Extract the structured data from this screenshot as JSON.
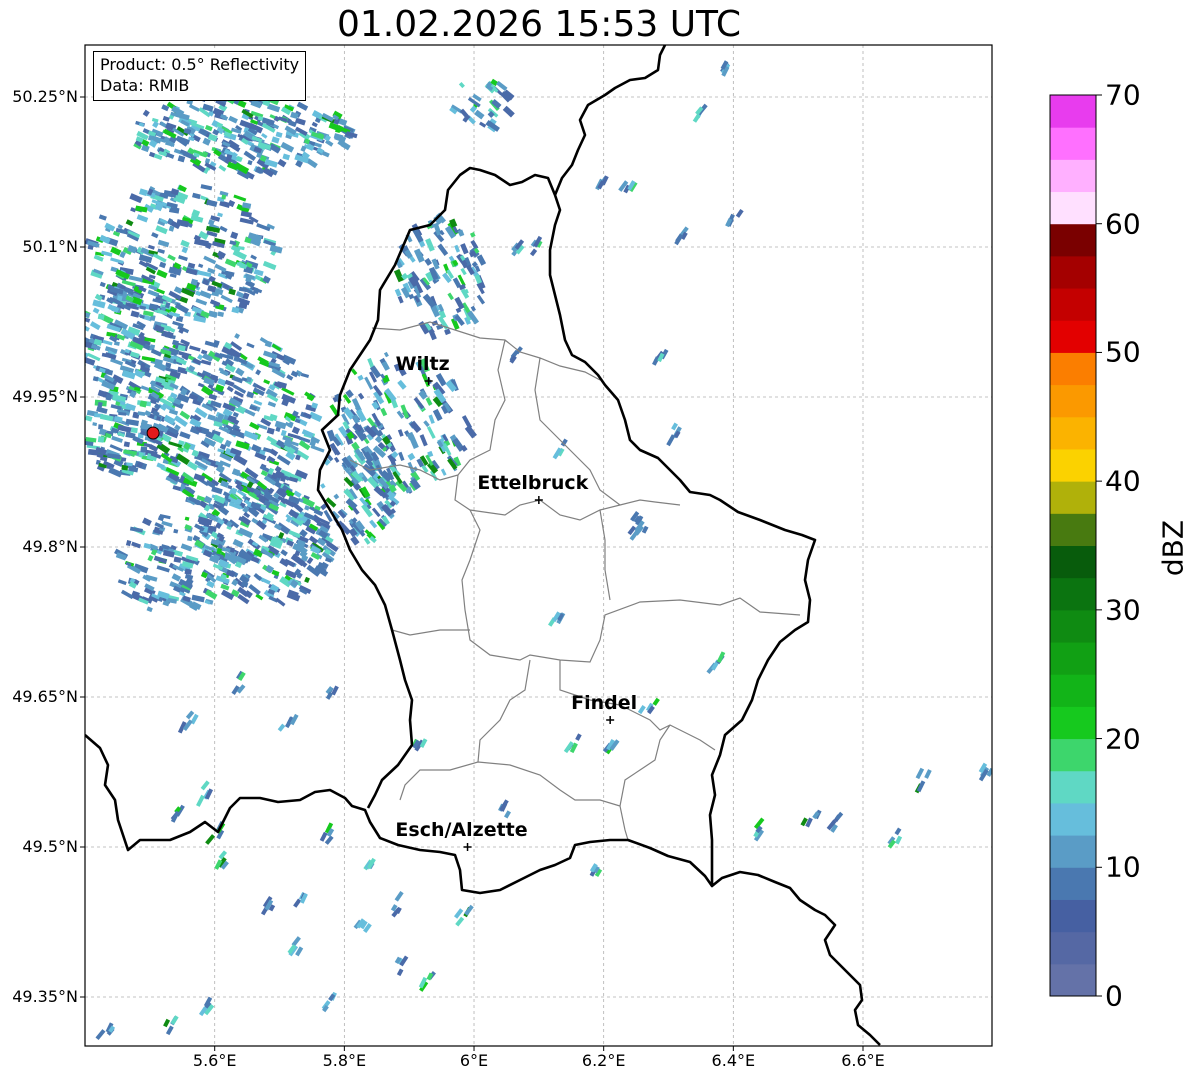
{
  "title": "01.02.2026 15:53 UTC",
  "info": {
    "product": "Product: 0.5° Reflectivity",
    "data": "Data: RMIB"
  },
  "lat_ticks": [
    {
      "value": 50.25,
      "label": "50.25°N"
    },
    {
      "value": 50.1,
      "label": "50.1°N"
    },
    {
      "value": 49.95,
      "label": "49.95°N"
    },
    {
      "value": 49.8,
      "label": "49.8°N"
    },
    {
      "value": 49.65,
      "label": "49.65°N"
    },
    {
      "value": 49.5,
      "label": "49.5°N"
    },
    {
      "value": 49.35,
      "label": "49.35°N"
    }
  ],
  "lon_ticks": [
    {
      "value": 5.6,
      "label": "5.6°E"
    },
    {
      "value": 5.8,
      "label": "5.8°E"
    },
    {
      "value": 6.0,
      "label": "6°E"
    },
    {
      "value": 6.2,
      "label": "6.2°E"
    },
    {
      "value": 6.4,
      "label": "6.4°E"
    },
    {
      "value": 6.6,
      "label": "6.6°E"
    }
  ],
  "cities": [
    {
      "name": "Wiltz",
      "lon": 5.93,
      "lat": 49.966
    },
    {
      "name": "Ettelbruck",
      "lon": 6.1,
      "lat": 49.847
    },
    {
      "name": "Findel",
      "lon": 6.21,
      "lat": 49.627
    },
    {
      "name": "Esch/Alzette",
      "lon": 5.99,
      "lat": 49.5
    }
  ],
  "radar_site": {
    "lon": 5.505,
    "lat": 49.914,
    "color": "#e41a1c"
  },
  "colorbar": {
    "label": "dBZ",
    "min": 0,
    "max": 70,
    "step": 2.5,
    "tick_labels": [
      "0",
      "10",
      "20",
      "30",
      "40",
      "50",
      "60",
      "70"
    ],
    "colors": [
      "#6472a8",
      "#5568a4",
      "#4660a2",
      "#4a78b0",
      "#5a9cc6",
      "#66bedc",
      "#5fd8c4",
      "#3dd66c",
      "#16c91e",
      "#12b418",
      "#11a014",
      "#0f8b12",
      "#0b7410",
      "#085c0c",
      "#487a10",
      "#b0b10a",
      "#fbd200",
      "#fbb300",
      "#fb9900",
      "#fb7e00",
      "#e30000",
      "#c40000",
      "#a40000",
      "#7a0000",
      "#ffe0ff",
      "#ffb0ff",
      "#ff70ff",
      "#e83cee"
    ]
  }
}
